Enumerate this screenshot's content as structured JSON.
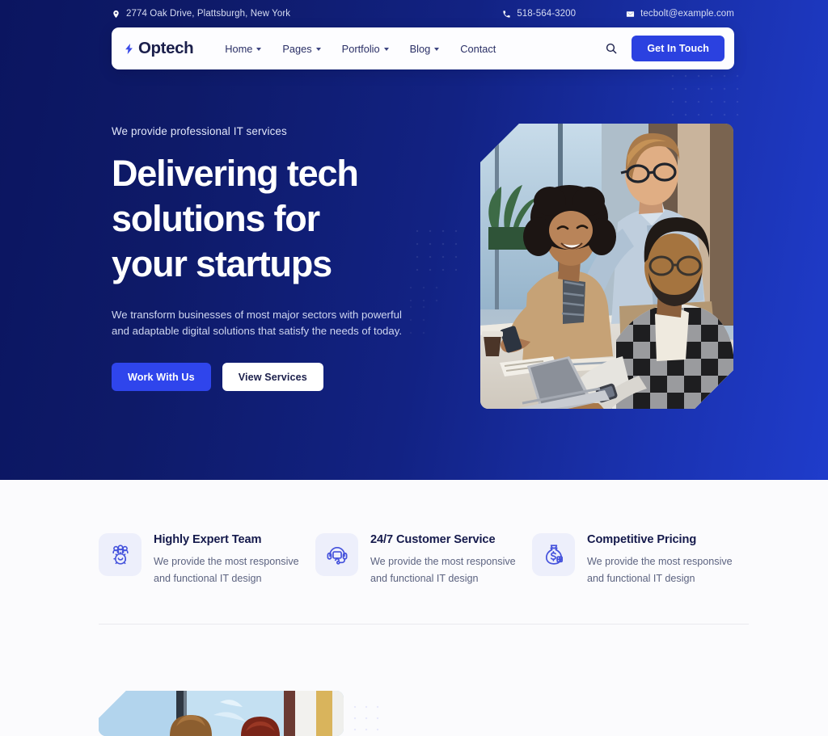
{
  "topbar": {
    "address": "2774 Oak Drive, Plattsburgh, New York",
    "address_icon": "location-pin-icon",
    "phone": "518-564-3200",
    "phone_icon": "phone-icon",
    "email": "tecbolt@example.com",
    "email_icon": "envelope-icon"
  },
  "navbar": {
    "logo_text": "Optech",
    "logo_icon": "lightning-bolt-icon",
    "menu": [
      {
        "label": "Home",
        "has_dropdown": true
      },
      {
        "label": "Pages",
        "has_dropdown": true
      },
      {
        "label": "Portfolio",
        "has_dropdown": true
      },
      {
        "label": "Blog",
        "has_dropdown": true
      },
      {
        "label": "Contact",
        "has_dropdown": false
      }
    ],
    "search_icon": "search-icon",
    "cta_label": "Get In Touch"
  },
  "hero": {
    "eyebrow": "We provide professional IT services",
    "title_line1": "Delivering tech",
    "title_line2": "solutions for",
    "title_line3": "your startups",
    "subtitle": "We transform businesses of most major sectors with powerful and adaptable digital solutions that satisfy the needs of today.",
    "primary_button": "Work With Us",
    "secondary_button": "View Services",
    "image_alt": "three colleagues collaborating at an office desk with a laptop"
  },
  "features": [
    {
      "icon": "team-gear-icon",
      "title": "Highly Expert Team",
      "description": "We provide the most responsive and functional IT design"
    },
    {
      "icon": "headset-support-icon",
      "title": "24/7 Customer Service",
      "description": "We provide the most responsive and functional IT design"
    },
    {
      "icon": "money-bag-icon",
      "title": "Competitive Pricing",
      "description": "We provide the most responsive and functional IT design"
    }
  ],
  "next_section": {
    "image_alt": "two people near a window, partially visible image"
  },
  "colors": {
    "brand_blue": "#2B41E0",
    "hero_gradient_start": "#0B1560",
    "hero_gradient_end": "#1F3CCB",
    "heading_navy": "#151A4C",
    "icon_tile_bg": "#EDEFFB",
    "page_bg": "#FBFBFD",
    "divider": "#EAEAEF"
  }
}
